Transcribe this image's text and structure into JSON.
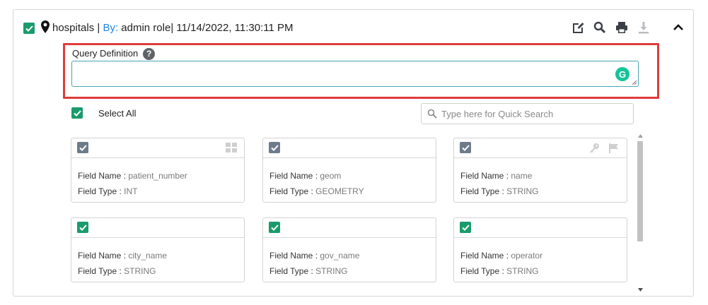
{
  "header": {
    "layer_name": "hospitals",
    "separator": " | ",
    "by_label": "By:",
    "author_date": " admin role| 11/14/2022, 11:30:11 PM",
    "icons": [
      "edit-icon",
      "search-icon",
      "print-icon",
      "download-icon"
    ],
    "collapse_icon": "chevron-up-icon"
  },
  "query": {
    "label": "Query Definition",
    "help_glyph": "?",
    "value": "",
    "grammarly_glyph": "G"
  },
  "select_all": {
    "label": "Select All",
    "checked": true
  },
  "search": {
    "placeholder": "Type here for Quick Search",
    "value": ""
  },
  "field_name_label": "Field Name :",
  "field_type_label": "Field Type :",
  "fields": [
    {
      "name": "patient_number",
      "type": "INT",
      "checked": true,
      "checkbox_color": "#6d7b8a",
      "icons": [
        "grid-icon"
      ]
    },
    {
      "name": "geom",
      "type": "GEOMETRY",
      "checked": true,
      "checkbox_color": "#6d7b8a",
      "icons": []
    },
    {
      "name": "name",
      "type": "STRING",
      "checked": true,
      "checkbox_color": "#6d7b8a",
      "icons": [
        "key-icon",
        "flag-icon"
      ]
    },
    {
      "name": "city_name",
      "type": "STRING",
      "checked": true,
      "checkbox_color": "#1a9b6c",
      "icons": []
    },
    {
      "name": "gov_name",
      "type": "STRING",
      "checked": true,
      "checkbox_color": "#1a9b6c",
      "icons": []
    },
    {
      "name": "operator",
      "type": "STRING",
      "checked": true,
      "checkbox_color": "#1a9b6c",
      "icons": []
    }
  ],
  "colors": {
    "accent_green": "#1a9b6c",
    "highlight_red": "#e03b3b",
    "link_blue": "#1e88e5",
    "input_border": "#48a5b5"
  }
}
